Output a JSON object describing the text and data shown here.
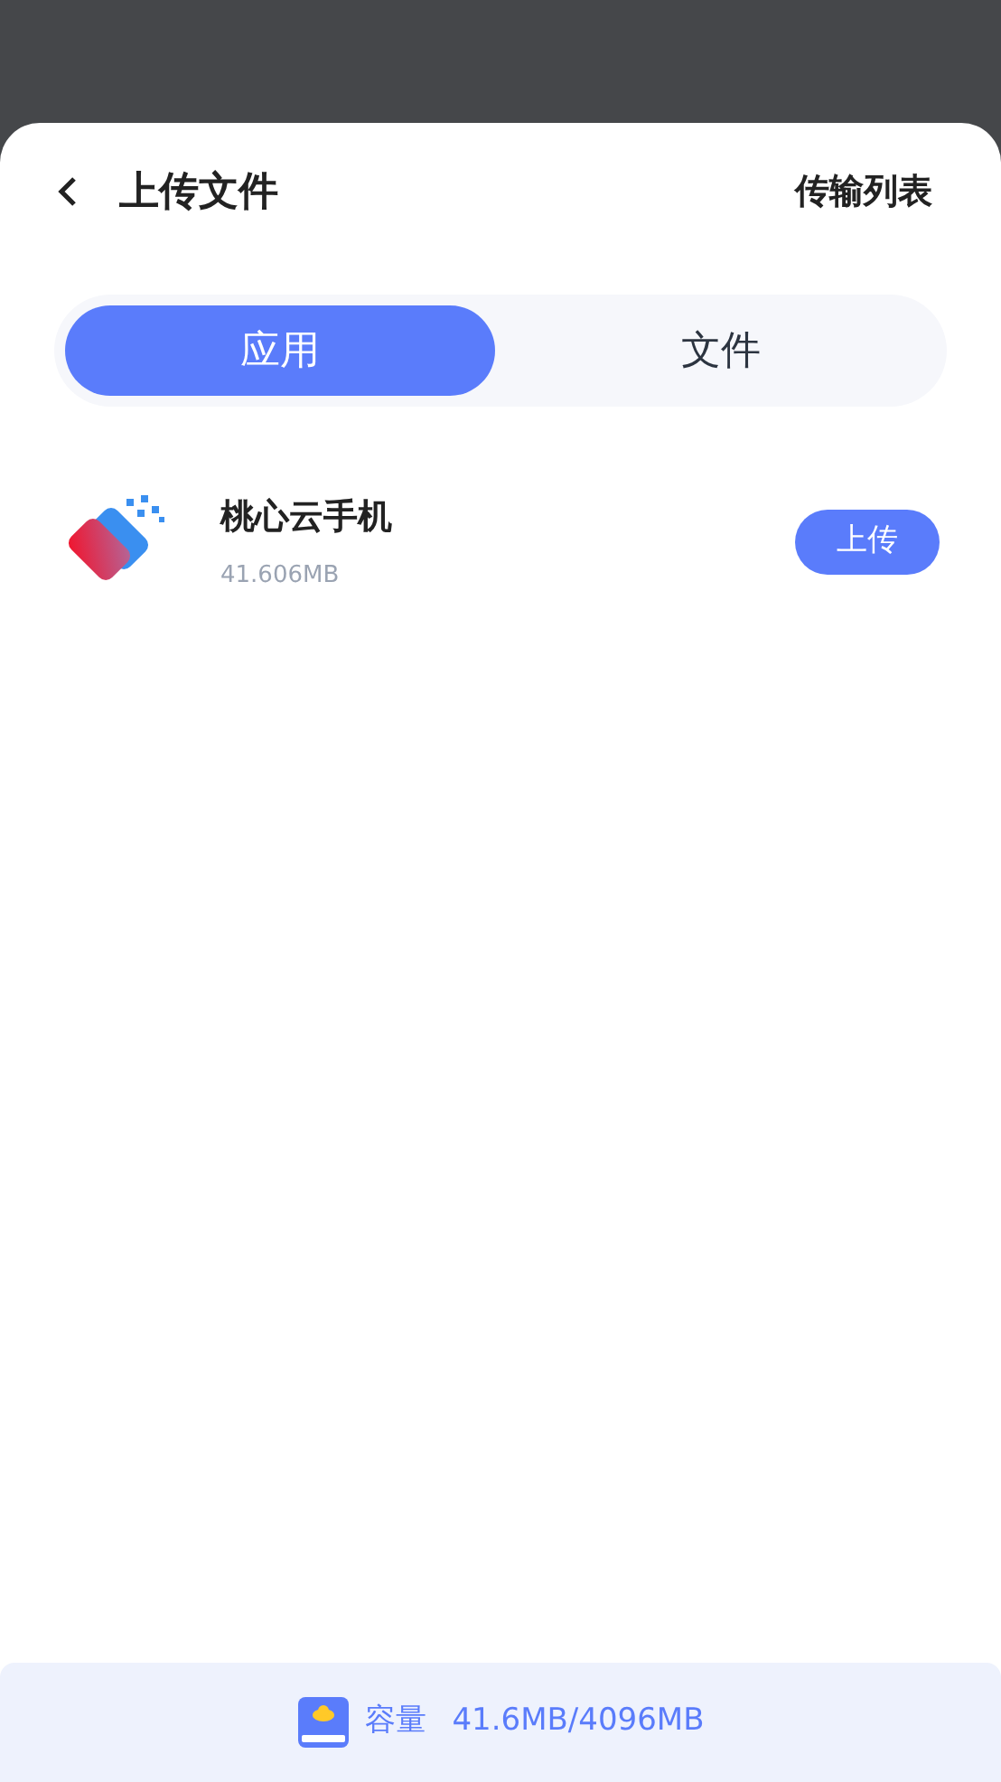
{
  "header": {
    "title": "上传文件",
    "action": "传输列表"
  },
  "tabs": [
    {
      "label": "应用",
      "selected": true
    },
    {
      "label": "文件",
      "selected": false
    }
  ],
  "apps": [
    {
      "name": "桃心云手机",
      "size": "41.606MB",
      "button": "上传"
    }
  ],
  "footer": {
    "label": "容量",
    "usage": "41.6MB/4096MB"
  }
}
